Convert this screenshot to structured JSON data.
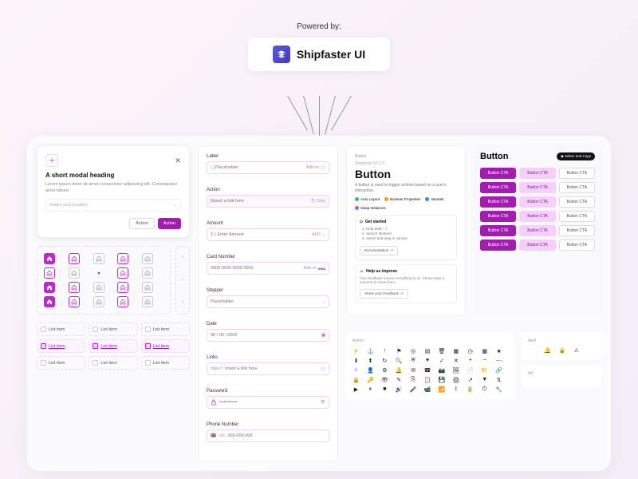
{
  "powered_by": "Powered by:",
  "brand": "Shipfaster UI",
  "modal": {
    "title": "A short modal heading",
    "desc": "Lorem ipsum dolor sit amet consectetur adipiscing elit. Consequatur amet labore.",
    "location_placeholder": "Select your location",
    "action_secondary": "Action",
    "action_primary": "Action"
  },
  "list": {
    "label": "List item"
  },
  "form": {
    "label": {
      "label": "Label",
      "placeholder": "Placeholder",
      "addon": "Add-on"
    },
    "action": {
      "label": "Action",
      "placeholder": "Insert a link here",
      "copy": "Copy"
    },
    "amount": {
      "label": "Amount",
      "prefix": "$",
      "placeholder": "Enter Amount",
      "currency": "AUD"
    },
    "card": {
      "label": "Card Number",
      "placeholder": "0000 0000 0000 0000",
      "addon": "Add-on",
      "brand": "VISA"
    },
    "stepper": {
      "label": "Stepper",
      "placeholder": "Placeholder"
    },
    "date": {
      "label": "Date",
      "placeholder": "00 / 00 / 0000"
    },
    "links": {
      "label": "Links",
      "prefix": "https://",
      "placeholder": "Insert a link here"
    },
    "password": {
      "label": "Password",
      "placeholder": "••••••••••••"
    },
    "phone": {
      "label": "Phone Number",
      "code": "+61",
      "placeholder": "000-000-000"
    }
  },
  "docs": {
    "section": "Button",
    "crumb": "Shipfaster UI 2.0",
    "title": "Button",
    "desc": "A button is used to trigger actions based on a user's interaction.",
    "tags": [
      "Auto Layout",
      "Boolean Properties",
      "Variants",
      "Swap Instances"
    ],
    "get_started": "Get started",
    "steps": [
      "Hold Shift + I",
      "Search 'Buttons'",
      "Select and drag in canvas"
    ],
    "documentation": "Documentation",
    "help_title": "Help us improve",
    "help_desc": "Your feedback means everything to us. Please take a moment to share them.",
    "share_feedback": "Share your Feedback"
  },
  "showcase": {
    "title": "Button",
    "badge": "Select and Copy",
    "cta": "Button CTA"
  },
  "icons_label": "Action",
  "alert_label": "Alert",
  "av_label": "AV"
}
